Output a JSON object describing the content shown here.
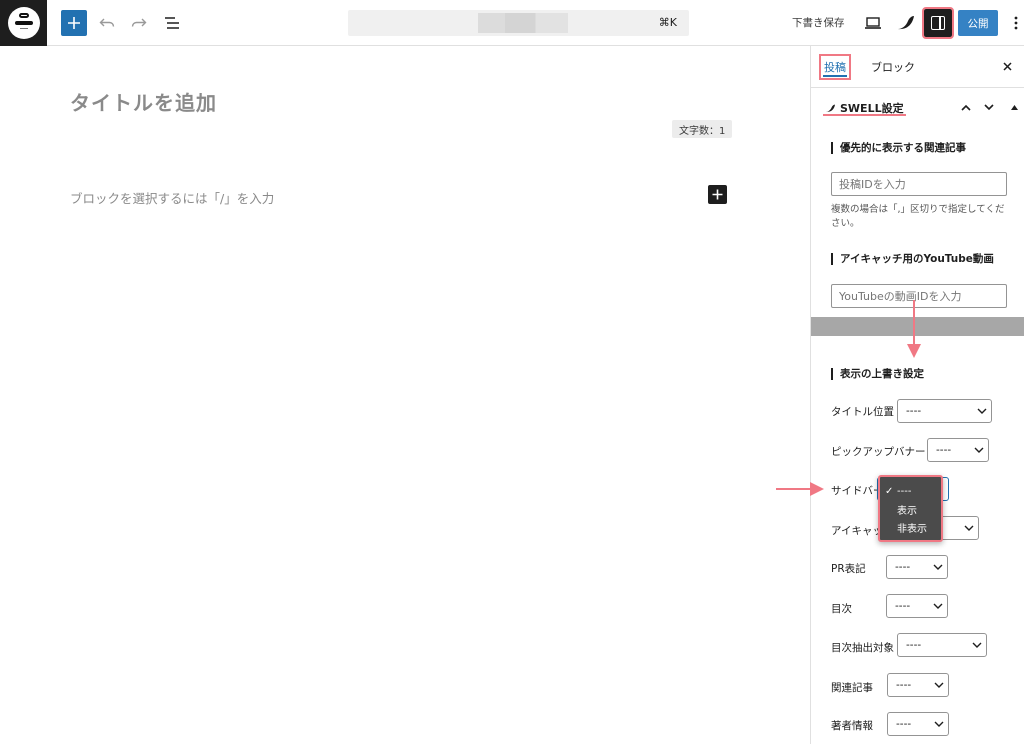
{
  "toolbar": {
    "shortcut": "⌘K",
    "save_draft": "下書き保存",
    "publish": "公開"
  },
  "editor": {
    "title_placeholder": "タイトルを追加",
    "char_count": "文字数：1",
    "block_placeholder": "ブロックを選択するには「/」を入力"
  },
  "sidebar": {
    "tabs": {
      "post": "投稿",
      "block": "ブロック"
    },
    "panel_title": "SWELL設定",
    "related": {
      "label": "優先的に表示する関連記事",
      "placeholder": "投稿IDを入力",
      "help": "複数の場合は「,」区切りで指定してください。"
    },
    "youtube": {
      "label": "アイキャッチ用のYouTube動画",
      "placeholder": "YouTubeの動画IDを入力"
    },
    "override": {
      "label": "表示の上書き設定",
      "rows": [
        {
          "label": "タイトル位置",
          "value": "----"
        },
        {
          "label": "ピックアップバナー",
          "value": "----"
        },
        {
          "label": "サイドバー",
          "value": "----"
        },
        {
          "label": "アイキャッチ",
          "value": "----"
        },
        {
          "label": "PR表記",
          "value": "----"
        },
        {
          "label": "目次",
          "value": "----"
        },
        {
          "label": "目次抽出対象",
          "value": "----"
        },
        {
          "label": "関連記事",
          "value": "----"
        },
        {
          "label": "著者情報",
          "value": "----"
        }
      ]
    },
    "dropdown_options": [
      "----",
      "表示",
      "非表示"
    ]
  },
  "colors": {
    "accent": "#2271b1",
    "highlight": "#f07884",
    "publish": "#3582c4"
  }
}
